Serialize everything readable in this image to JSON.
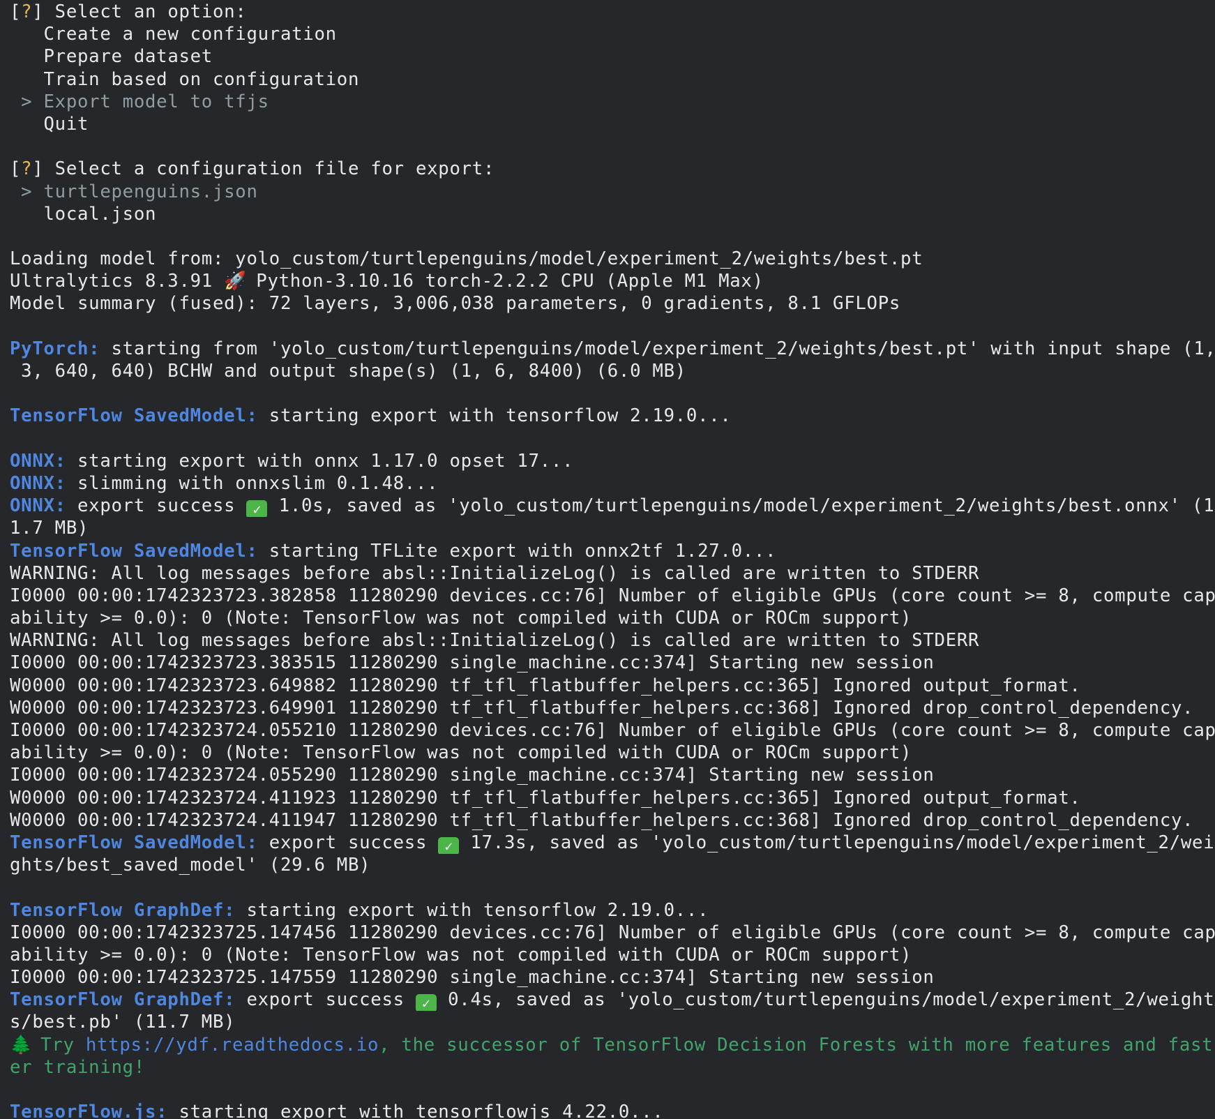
{
  "prompts": {
    "bracket_open": "[",
    "mark": "?",
    "bracket_close": "]",
    "pointer": " > ",
    "indent": "   "
  },
  "menu": {
    "question": " Select an option:",
    "options": [
      "Create a new configuration",
      "Prepare dataset",
      "Train based on configuration",
      "Export model to tfjs",
      "Quit"
    ]
  },
  "config_menu": {
    "question": " Select a configuration file for export:",
    "options": [
      "turtlepenguins.json",
      "local.json"
    ]
  },
  "load": {
    "line1": "Loading model from: yolo_custom/turtlepenguins/model/experiment_2/weights/best.pt",
    "line2_a": "Ultralytics 8.3.91 ",
    "line2_b": " Python-3.10.16 torch-2.2.2 CPU (Apple M1 Max)",
    "line3": "Model summary (fused): 72 layers, 3,006,038 parameters, 0 gradients, 8.1 GFLOPs"
  },
  "labels": {
    "pytorch": "PyTorch:",
    "tf_saved": "TensorFlow SavedModel:",
    "onnx": "ONNX:",
    "tf_graph": "TensorFlow GraphDef:",
    "tfjs": "TensorFlow.js:"
  },
  "icons": {
    "check_glyph": "✓"
  },
  "log": {
    "pytorch_1": " starting from 'yolo_custom/turtlepenguins/model/experiment_2/weights/best.pt' with input shape (1,",
    "pytorch_2": " 3, 640, 640) BCHW and output shape(s) (1, 6, 8400) (6.0 MB)",
    "tf_saved_start": " starting export with tensorflow 2.19.0...",
    "onnx_1": " starting export with onnx 1.17.0 opset 17...",
    "onnx_2": " slimming with onnxslim 0.1.48...",
    "onnx_3a": " export success ",
    "onnx_3b": " 1.0s, saved as 'yolo_custom/turtlepenguins/model/experiment_2/weights/best.onnx' (1",
    "onnx_4": "1.7 MB)",
    "tf_saved_tflite": " starting TFLite export with onnx2tf 1.27.0...",
    "warn_1": "WARNING: All log messages before absl::InitializeLog() is called are written to STDERR",
    "i1a": "I0000 00:00:1742323723.382858 11280290 devices.cc:76] Number of eligible GPUs (core count >= 8, compute cap",
    "i1b": "ability >= 0.0): 0 (Note: TensorFlow was not compiled with CUDA or ROCm support)",
    "warn_2": "WARNING: All log messages before absl::InitializeLog() is called are written to STDERR",
    "i2": "I0000 00:00:1742323723.383515 11280290 single_machine.cc:374] Starting new session",
    "w1": "W0000 00:00:1742323723.649882 11280290 tf_tfl_flatbuffer_helpers.cc:365] Ignored output_format.",
    "w2": "W0000 00:00:1742323723.649901 11280290 tf_tfl_flatbuffer_helpers.cc:368] Ignored drop_control_dependency.",
    "i3a": "I0000 00:00:1742323724.055210 11280290 devices.cc:76] Number of eligible GPUs (core count >= 8, compute cap",
    "i3b": "ability >= 0.0): 0 (Note: TensorFlow was not compiled with CUDA or ROCm support)",
    "i4": "I0000 00:00:1742323724.055290 11280290 single_machine.cc:374] Starting new session",
    "w3": "W0000 00:00:1742323724.411923 11280290 tf_tfl_flatbuffer_helpers.cc:365] Ignored output_format.",
    "w4": "W0000 00:00:1742323724.411947 11280290 tf_tfl_flatbuffer_helpers.cc:368] Ignored drop_control_dependency.",
    "tf_saved_ok_a": " export success ",
    "tf_saved_ok_b": " 17.3s, saved as 'yolo_custom/turtlepenguins/model/experiment_2/wei",
    "tf_saved_ok_c": "ghts/best_saved_model' (29.6 MB)",
    "tf_graph_start": " starting export with tensorflow 2.19.0...",
    "i5a": "I0000 00:00:1742323725.147456 11280290 devices.cc:76] Number of eligible GPUs (core count >= 8, compute cap",
    "i5b": "ability >= 0.0): 0 (Note: TensorFlow was not compiled with CUDA or ROCm support)",
    "i6": "I0000 00:00:1742323725.147559 11280290 single_machine.cc:374] Starting new session",
    "tf_graph_ok_a": " export success ",
    "tf_graph_ok_b": " 0.4s, saved as 'yolo_custom/turtlepenguins/model/experiment_2/weight",
    "tf_graph_ok_c": "s/best.pb' (11.7 MB)",
    "ydf_a": " Try ",
    "ydf_url": "https://ydf.readthedocs.io",
    "ydf_b": ", the successor of TensorFlow Decision Forests with more features and fast",
    "ydf_c": "er training!",
    "tfjs_start": " starting export with tensorflowjs 4.22.0..."
  }
}
